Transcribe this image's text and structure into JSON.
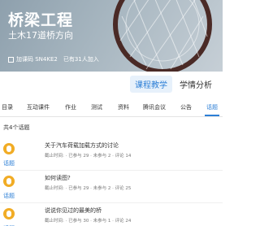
{
  "course": {
    "title": "桥梁工程",
    "subtitle": "土木17道桥方向",
    "join_code": "加课码 SN4KE2",
    "joined": "已有31人加入"
  },
  "mode_tabs": [
    "课程教学",
    "学情分析"
  ],
  "nav_tabs": [
    "目录",
    "互动课件",
    "作业",
    "测试",
    "资料",
    "腾讯会议",
    "公告",
    "话题"
  ],
  "topic_count": "共4个话题",
  "topics": [
    {
      "title": "关于汽车荷载加载方式的讨论",
      "meta": "截止时间: · 已参与 29 · 未参与 2 · 评论 14",
      "tag": "话题"
    },
    {
      "title": "如何读图?",
      "meta": "截止时间: · 已参与 29 · 未参与 2 · 评论 25",
      "tag": "话题"
    },
    {
      "title": "说说你见过的最美的桥",
      "meta": "截止时间: · 已参与 30 · 未参与 1 · 评论 24",
      "tag": "话题"
    }
  ],
  "colors": {
    "accent": "#2d7fd6",
    "avatar": "#f1ac25"
  }
}
